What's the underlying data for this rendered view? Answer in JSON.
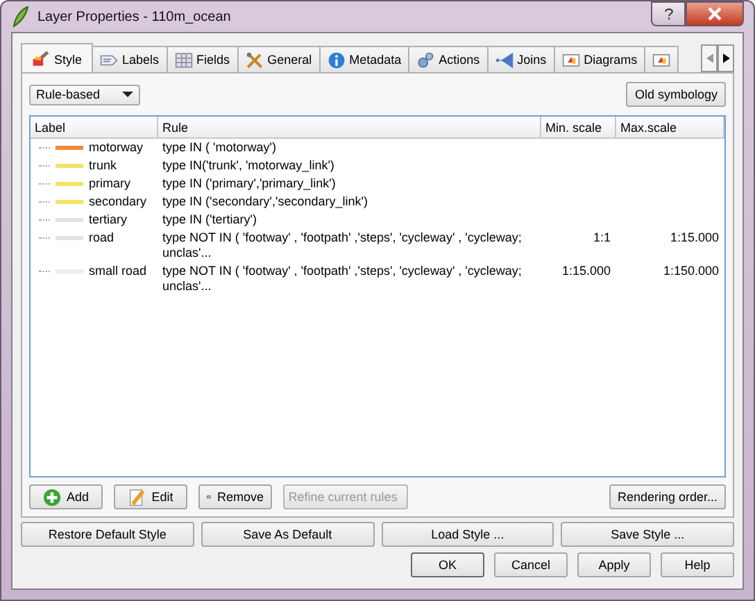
{
  "window": {
    "title": "Layer Properties - 110m_ocean"
  },
  "tabs": [
    {
      "label": "Style",
      "kind": "brush",
      "selected": true
    },
    {
      "label": "Labels",
      "kind": "label",
      "selected": false
    },
    {
      "label": "Fields",
      "kind": "grid",
      "selected": false
    },
    {
      "label": "General",
      "kind": "tools",
      "selected": false
    },
    {
      "label": "Metadata",
      "kind": "info",
      "selected": false
    },
    {
      "label": "Actions",
      "kind": "gears",
      "selected": false
    },
    {
      "label": "Joins",
      "kind": "join",
      "selected": false
    },
    {
      "label": "Diagrams",
      "kind": "diagram",
      "selected": false
    },
    {
      "kind": "diagram",
      "selected": false
    }
  ],
  "renderer": {
    "value": "Rule-based"
  },
  "old_symbology_button": "Old symbology",
  "table": {
    "columns": [
      "Label",
      "Rule",
      "Min. scale",
      "Max.scale"
    ],
    "rows": [
      {
        "label": "motorway",
        "color": "#f0883a",
        "rule": "type IN ( 'motorway')"
      },
      {
        "label": "trunk",
        "color": "#f5e26a",
        "rule": "type IN('trunk', 'motorway_link')"
      },
      {
        "label": "primary",
        "color": "#f5e26a",
        "rule": "type IN ('primary','primary_link')"
      },
      {
        "label": "secondary",
        "color": "#f5e26a",
        "rule": "type IN ('secondary','secondary_link')"
      },
      {
        "label": "tertiary",
        "color": "#e2e2e2",
        "rule": "type IN ('tertiary')"
      },
      {
        "label": "road",
        "color": "#e2e2e2",
        "rule": "type NOT IN ( 'footway' , 'footpath' ,'steps', 'cycleway' , 'cycleway; unclas'...",
        "min_scale": "1:1",
        "max_scale": "1:15.000"
      },
      {
        "label": "small road",
        "color": "#eeeeee",
        "rule": "type NOT IN ( 'footway' , 'footpath' ,'steps', 'cycleway' , 'cycleway; unclas'...",
        "min_scale": "1:15.000",
        "max_scale": "1:150.000"
      }
    ]
  },
  "rule_buttons": [
    {
      "label": "Add",
      "kind": "add",
      "disabled": false
    },
    {
      "label": "Edit",
      "kind": "edit",
      "disabled": false
    },
    {
      "label": "Remove",
      "kind": "remove",
      "disabled": false
    },
    {
      "label": "Refine current rules",
      "kind": "dropdown",
      "disabled": true
    }
  ],
  "rendering_order_button": "Rendering order...",
  "style_buttons": [
    "Restore Default Style",
    "Save As Default",
    "Load Style ...",
    "Save Style ..."
  ],
  "dialog_buttons": [
    "OK",
    "Cancel",
    "Apply",
    "Help"
  ]
}
